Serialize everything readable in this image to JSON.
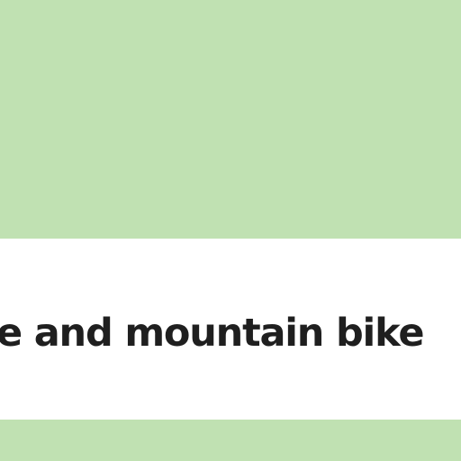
{
  "banner": {
    "text": "e and mountain bike"
  },
  "colors": {
    "background": "#c0e1b2",
    "banner": "#ffffff",
    "text": "#1f1f1f"
  }
}
